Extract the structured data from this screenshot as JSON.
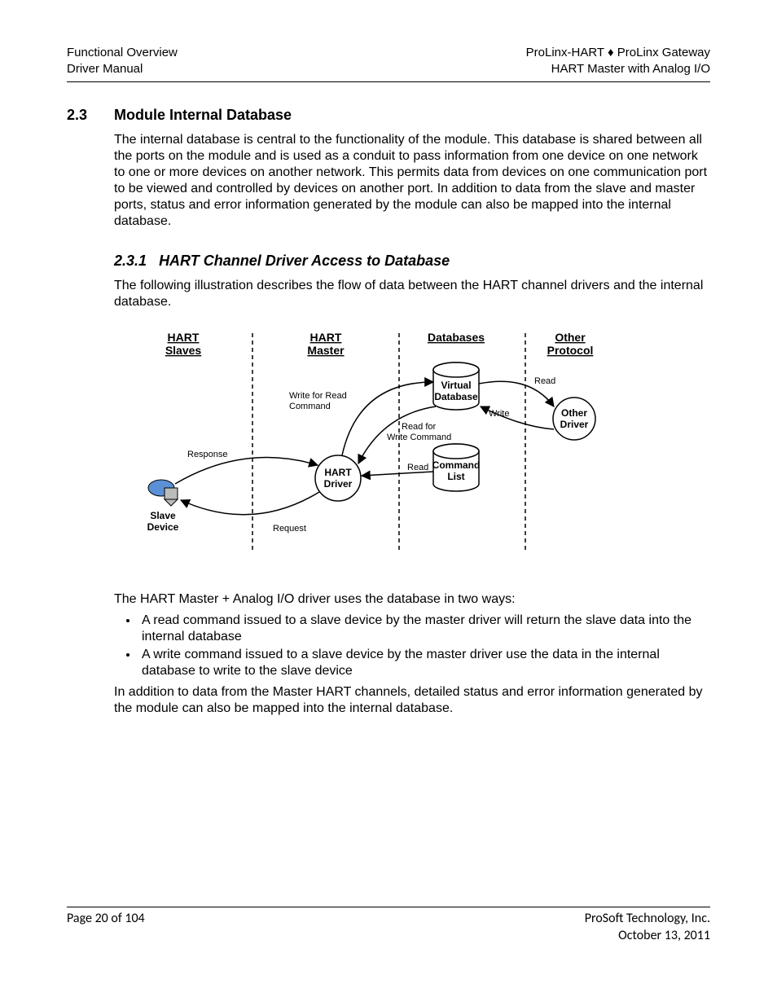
{
  "header": {
    "left_top": "Functional Overview",
    "left_bottom": "Driver Manual",
    "right_top": "ProLinx-HART ♦ ProLinx Gateway",
    "right_bottom": "HART Master with Analog I/O"
  },
  "section": {
    "number": "2.3",
    "title": "Module Internal Database",
    "para": "The internal database is central to the functionality of the module. This database is shared between all the ports on the module and is used as a conduit to pass information from one device on one network to one or more devices on another network. This permits data from devices on one communication port to be viewed and controlled by devices on another port. In addition to data from the slave and master ports, status and error information generated by the module can also be mapped into the internal database."
  },
  "subsection": {
    "number": "2.3.1",
    "title": "HART Channel Driver Access to Database",
    "para": "The following illustration describes the flow of data between the HART channel drivers and the internal database."
  },
  "diagram": {
    "col1_top": "HART",
    "col1_bot": "Slaves",
    "col2_top": "HART",
    "col2_bot": "Master",
    "col3": "Databases",
    "col4_top": "Other",
    "col4_bot": "Protocol",
    "virtual_db_top": "Virtual",
    "virtual_db_bot": "Database",
    "command_list_top": "Command",
    "command_list_bot": "List",
    "hart_driver_top": "HART",
    "hart_driver_bot": "Driver",
    "other_driver_top": "Other",
    "other_driver_bot": "Driver",
    "slave_device_top": "Slave",
    "slave_device_bot": "Device",
    "label_read1": "Read",
    "label_write": "Write",
    "label_write_for_read_top": "Write for Read",
    "label_write_for_read_bot": "Command",
    "label_read_for_top": "Read for",
    "label_read_for_bot": "Write Command",
    "label_response": "Response",
    "label_request": "Request",
    "label_read2": "Read"
  },
  "after_diagram": {
    "para1": "The HART Master + Analog I/O driver uses the database in two ways:",
    "bullet1": "A read command issued to a slave device by the master driver will return the slave data into the internal database",
    "bullet2": "A write command issued to a slave device by the master driver use the data in the internal database to write to the slave device",
    "para2": "In addition to data from the Master HART channels, detailed status and error information generated by the module can also be mapped into the internal database."
  },
  "footer": {
    "left": "Page 20 of 104",
    "right_top": "ProSoft Technology, Inc.",
    "right_bottom": "October 13, 2011"
  }
}
